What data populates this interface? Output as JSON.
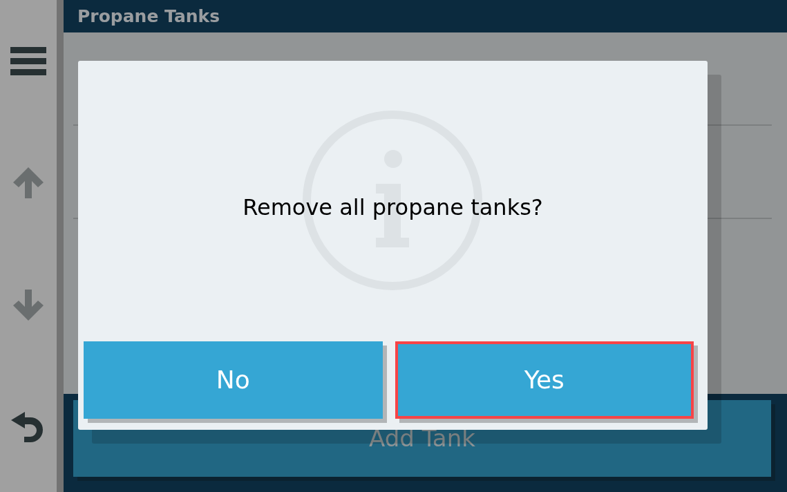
{
  "header": {
    "title": "Propane Tanks"
  },
  "add_button": {
    "label": "Add Tank"
  },
  "dialog": {
    "message": "Remove all propane tanks?",
    "buttons": [
      {
        "label": "No",
        "selected": false
      },
      {
        "label": "Yes",
        "selected": true
      }
    ]
  }
}
